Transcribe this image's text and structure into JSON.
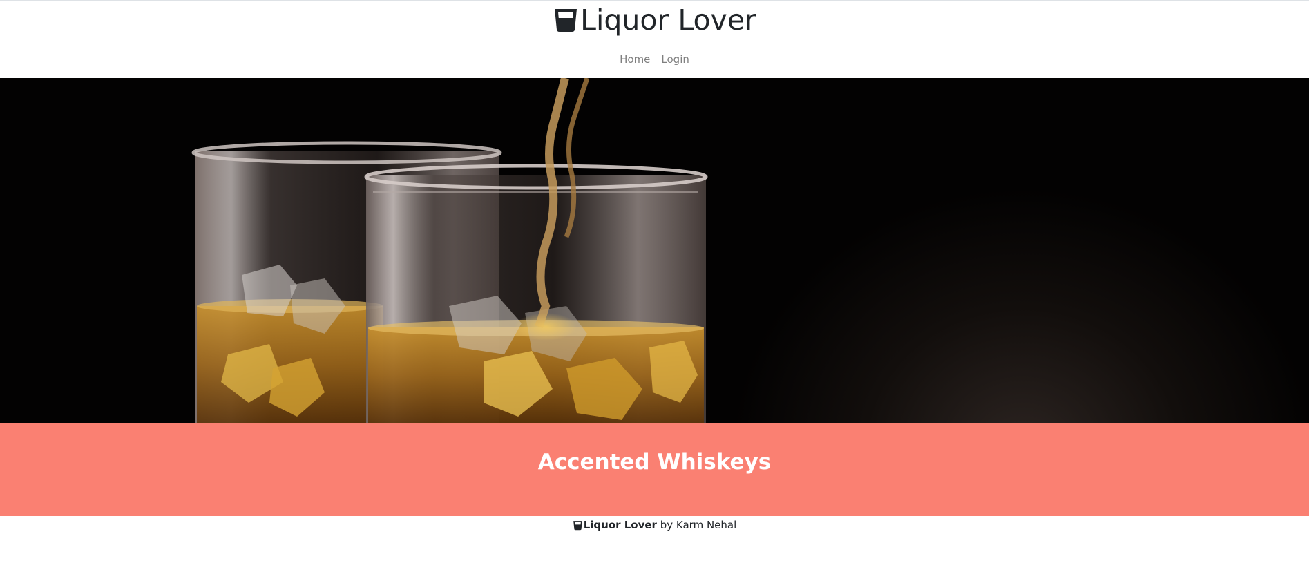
{
  "header": {
    "brand_name": "Liquor Lover",
    "brand_icon": "glass-whiskey-icon"
  },
  "nav": {
    "items": [
      {
        "label": "Home"
      },
      {
        "label": "Login"
      }
    ]
  },
  "hero": {
    "image": "whiskey-glasses-photo"
  },
  "banner": {
    "title": "Accented Whiskeys",
    "color": "#fa8072"
  },
  "footer": {
    "brand_name": "Liquor Lover",
    "byline": " by Karm Nehal",
    "brand_icon": "glass-whiskey-icon"
  }
}
